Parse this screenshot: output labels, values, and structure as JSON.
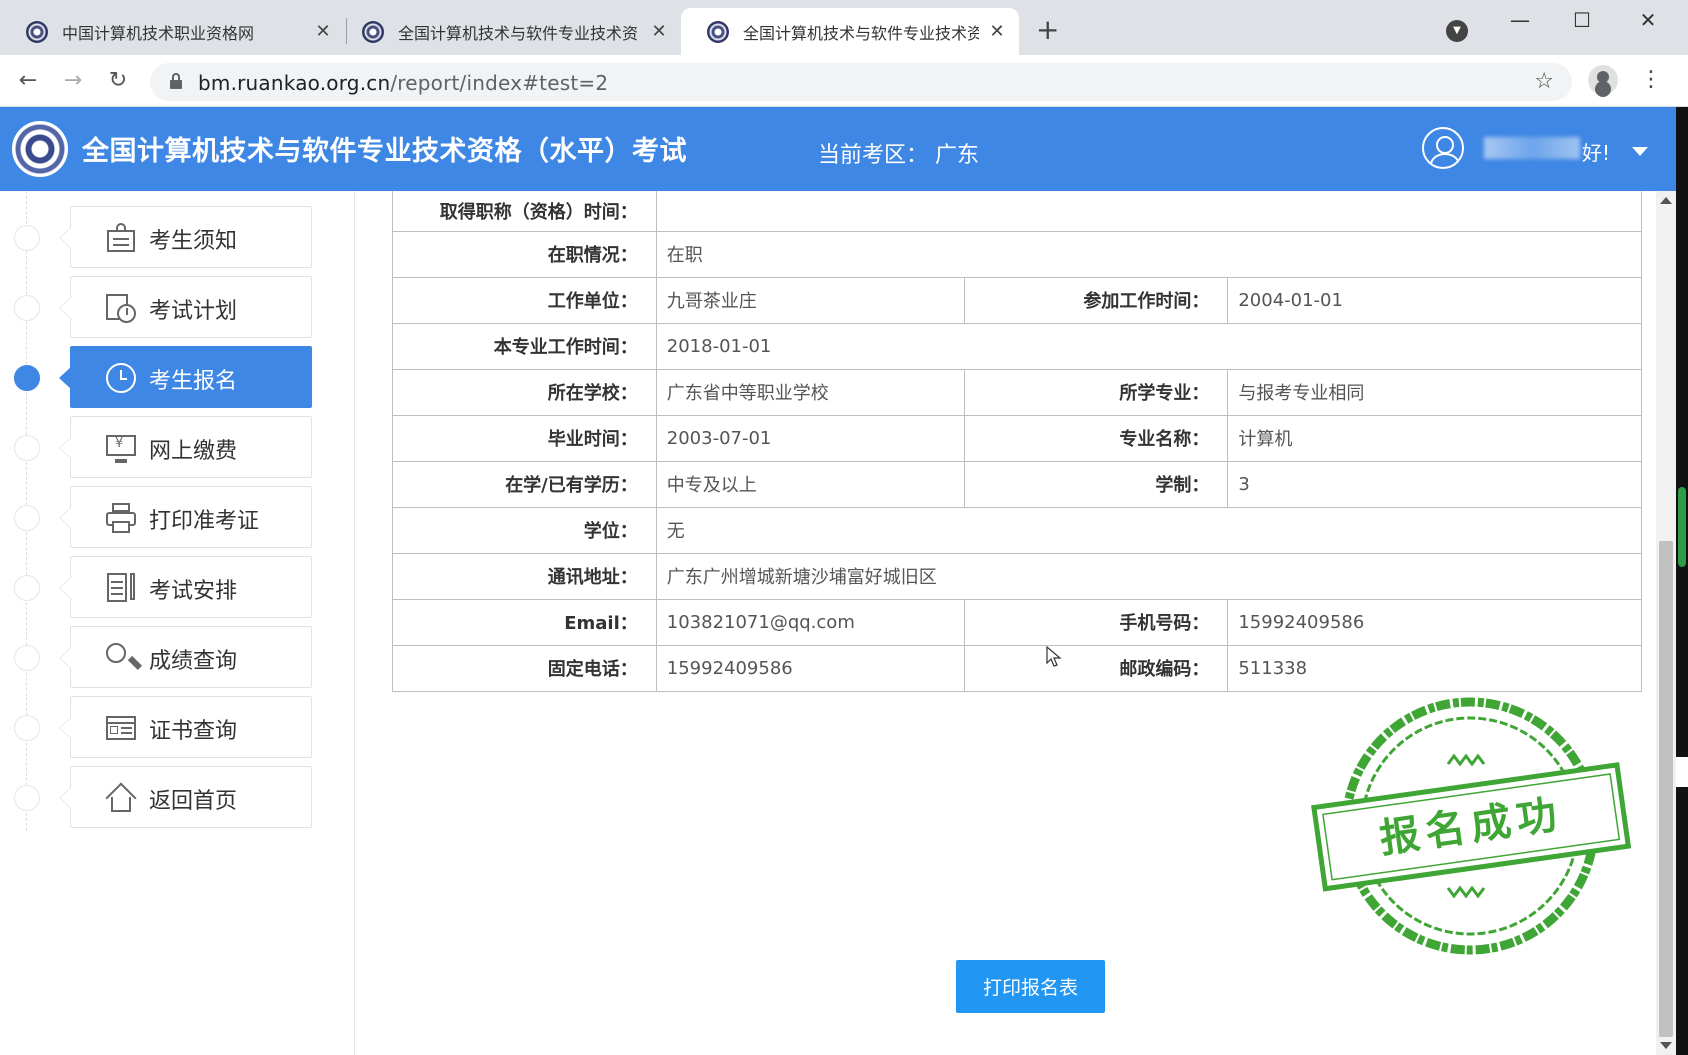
{
  "browser": {
    "tabs": [
      {
        "title": "中国计算机技术职业资格网",
        "active": false
      },
      {
        "title": "全国计算机技术与软件专业技术资",
        "active": false
      },
      {
        "title": "全国计算机技术与软件专业技术资",
        "active": true
      }
    ],
    "url_host": "bm.ruankao.org.cn",
    "url_path": "/report/index#test=2",
    "icons": {
      "back": "arrow-left-icon",
      "forward": "arrow-right-icon",
      "reload": "reload-icon",
      "lock": "lock-icon",
      "bookmark": "star-icon",
      "profile": "profile-icon",
      "menu": "kebab-menu-icon"
    }
  },
  "header": {
    "title": "全国计算机技术与软件专业技术资格（水平）考试",
    "region_label": "当前考区：",
    "region_value": "广东",
    "greeting": "好!",
    "brand_color": "#3e87e4"
  },
  "sidebar": {
    "items": [
      {
        "label": "考生须知",
        "icon": "notice-board-icon",
        "active": false
      },
      {
        "label": "考试计划",
        "icon": "calendar-clock-icon",
        "active": false
      },
      {
        "label": "考生报名",
        "icon": "clock-icon",
        "active": true
      },
      {
        "label": "网上缴费",
        "icon": "monitor-yen-icon",
        "active": false
      },
      {
        "label": "打印准考证",
        "icon": "printer-icon",
        "active": false
      },
      {
        "label": "考试安排",
        "icon": "document-pen-icon",
        "active": false
      },
      {
        "label": "成绩查询",
        "icon": "magnifier-icon",
        "active": false
      },
      {
        "label": "证书查询",
        "icon": "certificate-icon",
        "active": false
      },
      {
        "label": "返回首页",
        "icon": "home-icon",
        "active": false
      }
    ]
  },
  "form": {
    "rows": [
      {
        "cells": [
          {
            "label": "取得职称（资格）时间：",
            "value": ""
          }
        ]
      },
      {
        "cells": [
          {
            "label": "在职情况：",
            "value": "在职"
          }
        ]
      },
      {
        "cells": [
          {
            "label": "工作单位：",
            "value": "九哥茶业庄"
          },
          {
            "label": "参加工作时间：",
            "value": "2004-01-01"
          }
        ]
      },
      {
        "cells": [
          {
            "label": "本专业工作时间：",
            "value": "2018-01-01"
          }
        ]
      },
      {
        "cells": [
          {
            "label": "所在学校：",
            "value": "广东省中等职业学校"
          },
          {
            "label": "所学专业：",
            "value": "与报考专业相同"
          }
        ]
      },
      {
        "cells": [
          {
            "label": "毕业时间：",
            "value": "2003-07-01"
          },
          {
            "label": "专业名称：",
            "value": "计算机"
          }
        ]
      },
      {
        "cells": [
          {
            "label": "在学/已有学历：",
            "value": "中专及以上"
          },
          {
            "label": "学制：",
            "value": "3"
          }
        ]
      },
      {
        "cells": [
          {
            "label": "学位：",
            "value": "无"
          }
        ]
      },
      {
        "cells": [
          {
            "label": "通讯地址：",
            "value": "广东广州增城新塘沙埔富好城旧区"
          }
        ]
      },
      {
        "cells": [
          {
            "label": "Email：",
            "value": "103821071@qq.com"
          },
          {
            "label": "手机号码：",
            "value": "15992409586"
          }
        ]
      },
      {
        "cells": [
          {
            "label": "固定电话：",
            "value": "15992409586"
          },
          {
            "label": "邮政编码：",
            "value": "511338"
          }
        ]
      }
    ]
  },
  "stamp": {
    "text": "报名成功",
    "color": "#3fa535"
  },
  "actions": {
    "print_label": "打印报名表"
  }
}
